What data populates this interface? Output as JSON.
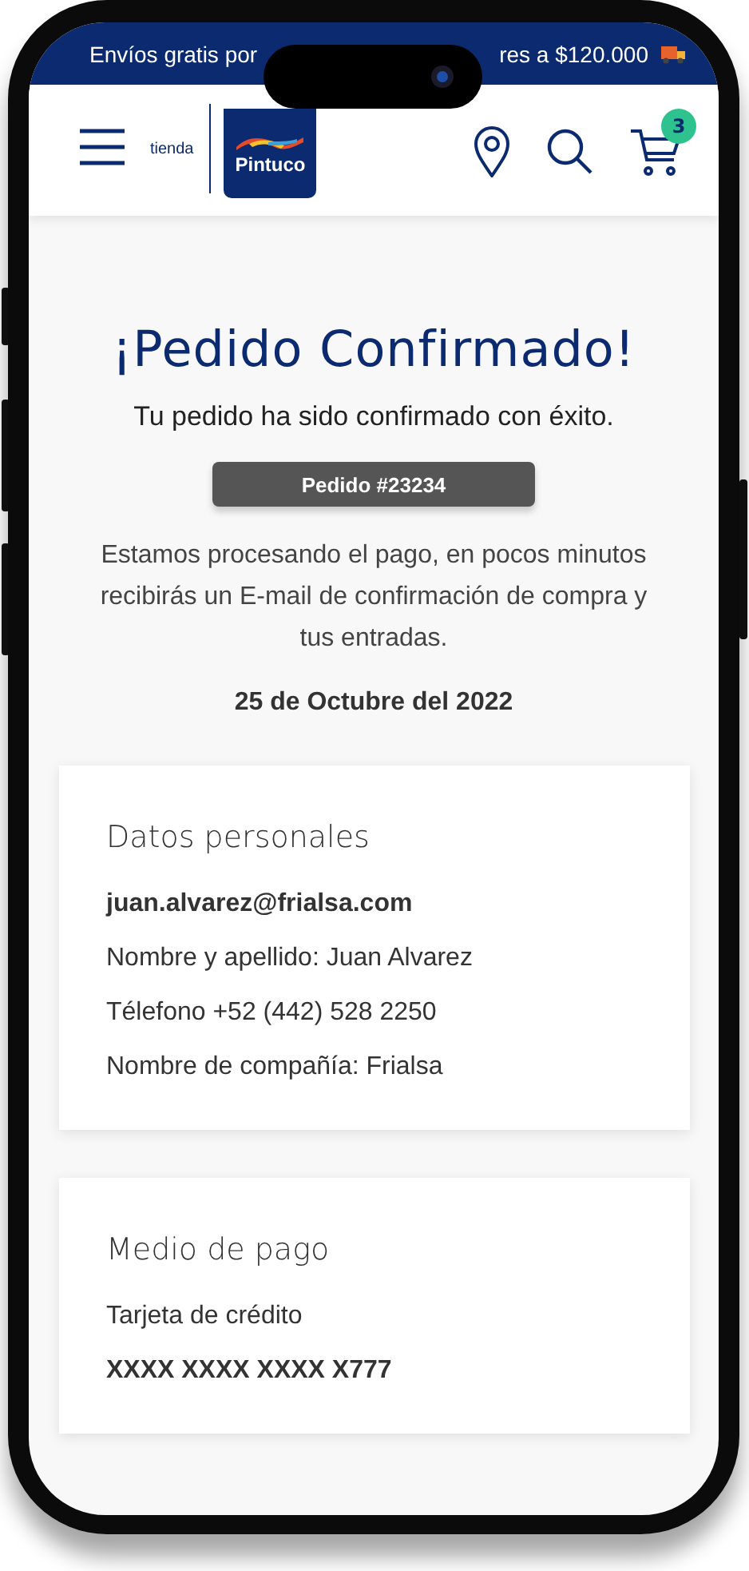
{
  "promo_banner": {
    "text_left": "Envíos gratis por",
    "text_right": "res a $120.000"
  },
  "header": {
    "store_label": "tienda",
    "logo_text": "Pintuco",
    "cart_count": "3"
  },
  "confirmation": {
    "title": "¡Pedido Confirmado!",
    "subtitle": "Tu pedido ha sido confirmado con éxito.",
    "order_badge": "Pedido #23234",
    "message": "Estamos procesando el pago, en pocos minutos recibirás un E-mail de confirmación de compra y tus entradas.",
    "date": "25 de Octubre del 2022"
  },
  "cards": [
    {
      "title": "Datos personales",
      "lines": [
        {
          "text": "juan.alvarez@frialsa.com",
          "kind": "bold"
        },
        {
          "text": "Nombre y apellido: Juan Alvarez",
          "kind": "plain"
        },
        {
          "text": "Télefono +52 (442) 528 2250",
          "kind": "plain"
        },
        {
          "text": "Nombre de compañía: Frialsa",
          "kind": "plain"
        }
      ]
    },
    {
      "title": "Medio de pago",
      "lines": [
        {
          "text": "Tarjeta de crédito",
          "kind": "plain"
        },
        {
          "text": "XXXX XXXX XXXX X777",
          "kind": "bold"
        }
      ]
    }
  ]
}
